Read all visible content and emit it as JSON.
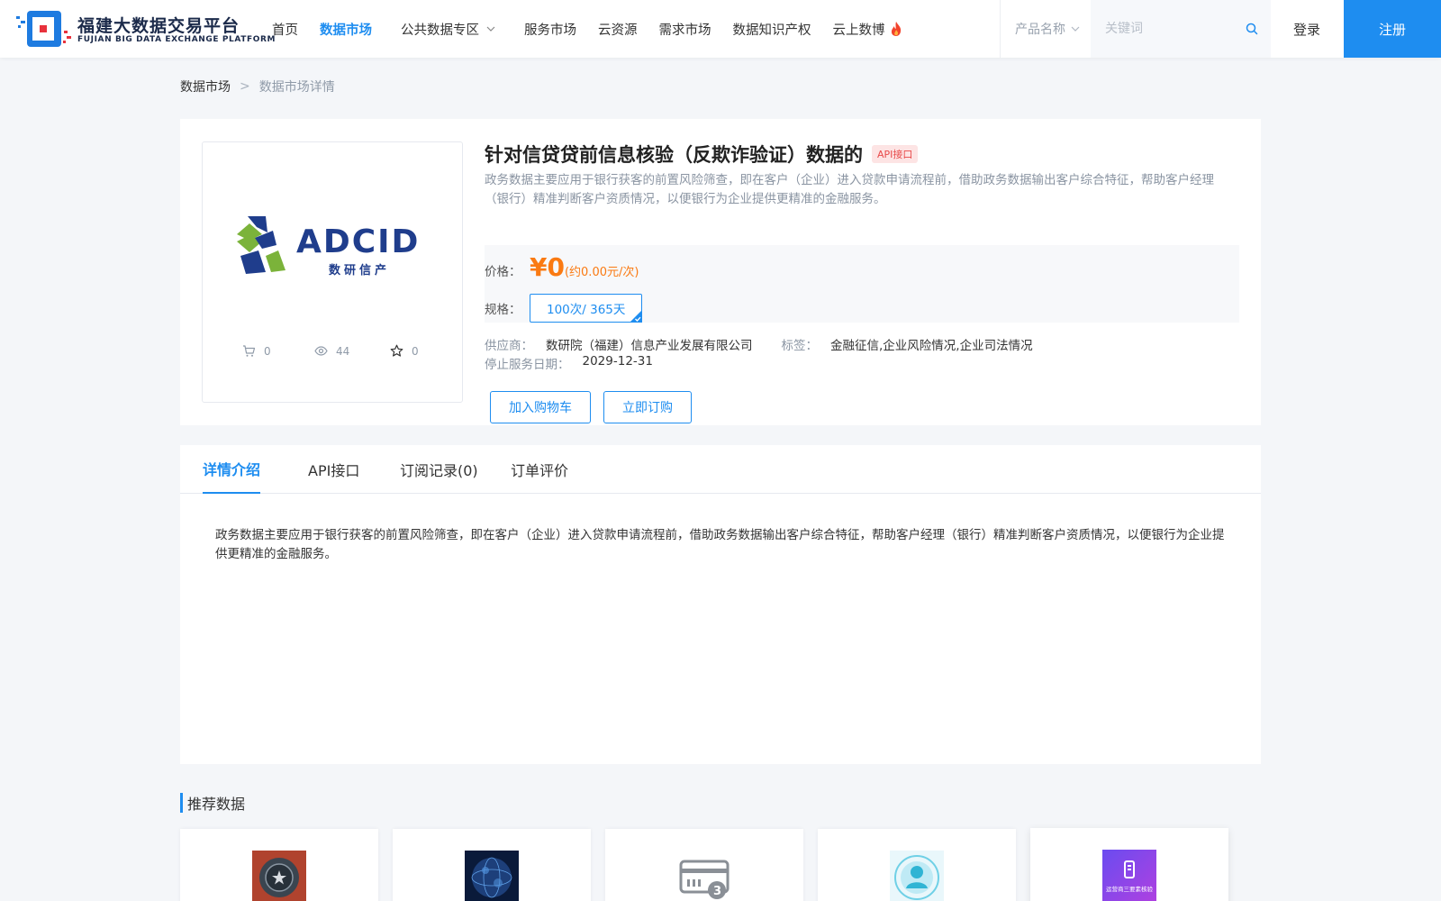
{
  "header": {
    "logo_cn": "福建大数据交易平台",
    "logo_en": "FUJIAN BIG DATA EXCHANGE  PLATFORM",
    "nav": [
      {
        "label": "首页"
      },
      {
        "label": "数据市场",
        "active": true
      },
      {
        "label": "公共数据专区",
        "dropdown": true
      },
      {
        "label": "服务市场"
      },
      {
        "label": "云资源"
      },
      {
        "label": "需求市场"
      },
      {
        "label": "数据知识产权"
      },
      {
        "label": "云上数博",
        "badge_icon": "flame-icon"
      }
    ],
    "search": {
      "category": "产品名称",
      "placeholder": "关键词"
    },
    "login_label": "登录",
    "register_label": "注册"
  },
  "breadcrumb": {
    "root": "数据市场",
    "separator": ">",
    "current": "数据市场详情"
  },
  "product": {
    "image_logo_text": "ADCID",
    "image_logo_sub": "数研信产",
    "stats": {
      "cart": "0",
      "views": "44",
      "favorites": "0"
    },
    "title": "针对信贷贷前信息核验（反欺诈验证）数据的",
    "tag": "API接口",
    "description": "政务数据主要应用于银行获客的前置风险筛查，即在客户（企业）进入贷款申请流程前，借助政务数据输出客户综合特征，帮助客户经理（银行）精准判断客户资质情况，以便银行为企业提供更精准的金融服务。",
    "price_label": "价格：",
    "price": "¥0",
    "price_note": "(约0.00元/次)",
    "spec_label": "规格：",
    "spec_value": "100次/ 365天",
    "supplier_label": "供应商：",
    "supplier": "数研院（福建）信息产业发展有限公司",
    "tags_label": "标签：",
    "tags": "金融征信,企业风险情况,企业司法情况",
    "stop_date_label": "停止服务日期：",
    "stop_date": "2029-12-31",
    "add_cart_label": "加入购物车",
    "buy_label": "立即订购"
  },
  "tabs": {
    "items": [
      {
        "label": "详情介绍",
        "active": true
      },
      {
        "label": "API接口"
      },
      {
        "label": "订阅记录(0)"
      },
      {
        "label": "订单评价"
      }
    ],
    "content": "政务数据主要应用于银行获客的前置风险筛查，即在客户（企业）进入贷款申请流程前，借助政务数据输出客户综合特征，帮助客户经理（银行）精准判断客户资质情况，以便银行为企业提供更精准的金融服务。"
  },
  "recommend": {
    "title": "推荐数据",
    "thumb_4_text": "运营商三要素核验",
    "cards": [
      {
        "icon": "shield-badge-icon"
      },
      {
        "icon": "globe-icon"
      },
      {
        "icon": "id-card-icon"
      },
      {
        "icon": "user-scan-icon"
      },
      {
        "icon": "phone-verify-icon"
      }
    ]
  },
  "colors": {
    "primary": "#1e8df0",
    "price": "#fa7a12",
    "tag_bg": "#fde4e4",
    "tag_text": "#e84a4a"
  }
}
